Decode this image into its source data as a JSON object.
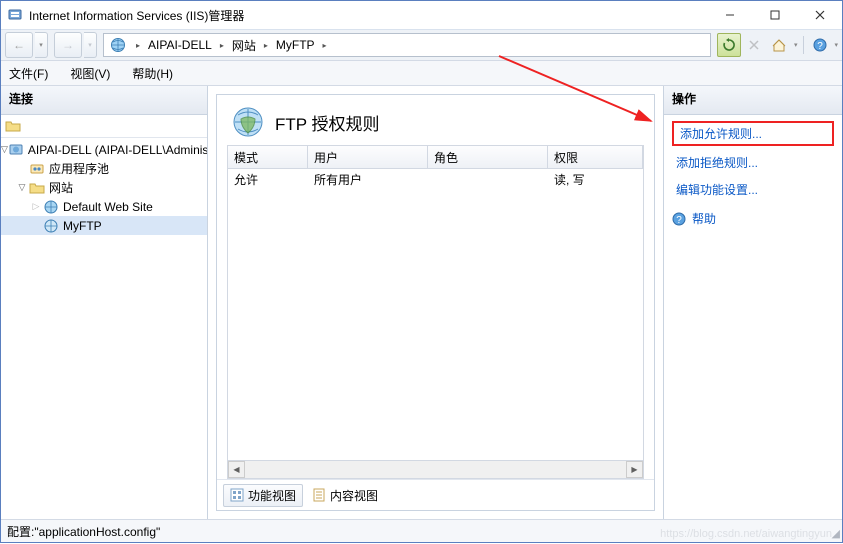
{
  "window": {
    "title": "Internet Information Services (IIS)管理器"
  },
  "breadcrumbs": {
    "a": "AIPAI-DELL",
    "b": "网站",
    "c": "MyFTP"
  },
  "menu": {
    "file": "文件(F)",
    "view": "视图(V)",
    "help": "帮助(H)"
  },
  "connections": {
    "header": "连接",
    "server": "AIPAI-DELL (AIPAI-DELL\\Administrator)",
    "apppools": "应用程序池",
    "sites": "网站",
    "default_site": "Default Web Site",
    "myftp": "MyFTP"
  },
  "main": {
    "title": "FTP 授权规则",
    "columns": {
      "mode": "模式",
      "user": "用户",
      "role": "角色",
      "perm": "权限"
    },
    "row": {
      "mode": "允许",
      "user": "所有用户",
      "role": "",
      "perm": "读, 写"
    },
    "tabs": {
      "features": "功能视图",
      "content": "内容视图"
    }
  },
  "actions": {
    "header": "操作",
    "add_allow": "添加允许规则...",
    "add_deny": "添加拒绝规则...",
    "edit_feature": "编辑功能设置...",
    "help": "帮助"
  },
  "status": {
    "text": "配置:\"applicationHost.config\"",
    "watermark": "https://blog.csdn.net/aiwangtingyun"
  }
}
